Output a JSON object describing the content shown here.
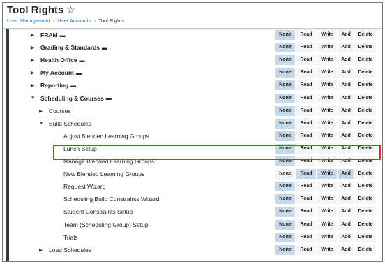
{
  "header": {
    "title": "Tool Rights",
    "star_icon": "star-outline-icon",
    "breadcrumb": [
      "User Management",
      "User Accounts",
      "Tool Rights"
    ]
  },
  "permission_labels": {
    "none": "None",
    "read": "Read",
    "write": "Write",
    "add": "Add",
    "delete": "Delete"
  },
  "colors": {
    "active_permission": "#c6d9ea",
    "highlight_border": "#d32f2f",
    "link": "#1a6fb8"
  },
  "rows": [
    {
      "label": "FRAM",
      "level": 1,
      "caret": "collapsed",
      "folder": true,
      "bold": true,
      "active": [
        "none"
      ]
    },
    {
      "label": "Grading & Standards",
      "level": 1,
      "caret": "collapsed",
      "folder": true,
      "bold": true,
      "active": [
        "none"
      ]
    },
    {
      "label": "Health Office",
      "level": 1,
      "caret": "collapsed",
      "folder": true,
      "bold": true,
      "active": [
        "none"
      ]
    },
    {
      "label": "My Account",
      "level": 1,
      "caret": "collapsed",
      "folder": true,
      "bold": true,
      "active": [
        "none"
      ]
    },
    {
      "label": "Reporting",
      "level": 1,
      "caret": "collapsed",
      "folder": true,
      "bold": true,
      "active": [
        "none"
      ]
    },
    {
      "label": "Scheduling & Courses",
      "level": 1,
      "caret": "expanded",
      "folder": true,
      "bold": true,
      "active": [
        "none"
      ]
    },
    {
      "label": "Courses",
      "level": 2,
      "caret": "collapsed",
      "folder": false,
      "bold": false,
      "active": [
        "none"
      ]
    },
    {
      "label": "Build Schedules",
      "level": 2,
      "caret": "expanded",
      "folder": false,
      "bold": false,
      "active": [
        "none"
      ]
    },
    {
      "label": "Adjust Blended Learning Groups",
      "level": 3,
      "caret": "",
      "folder": false,
      "bold": false,
      "active": [
        "none"
      ]
    },
    {
      "label": "Lunch Setup",
      "level": 3,
      "caret": "",
      "folder": false,
      "bold": false,
      "active": [
        "none"
      ]
    },
    {
      "label": "Manage Blended Learning Groups",
      "level": 3,
      "caret": "",
      "folder": false,
      "bold": false,
      "active": [
        "none"
      ]
    },
    {
      "label": "New Blended Learning Groups",
      "level": 3,
      "caret": "",
      "folder": false,
      "bold": false,
      "active": [
        "read",
        "write",
        "add"
      ],
      "highlighted": true
    },
    {
      "label": "Request Wizard",
      "level": 3,
      "caret": "",
      "folder": false,
      "bold": false,
      "active": [
        "none"
      ]
    },
    {
      "label": "Scheduling Build Constraints Wizard",
      "level": 3,
      "caret": "",
      "folder": false,
      "bold": false,
      "active": [
        "none"
      ]
    },
    {
      "label": "Student Constraints Setup",
      "level": 3,
      "caret": "",
      "folder": false,
      "bold": false,
      "active": [
        "none"
      ]
    },
    {
      "label": "Team (Scheduling Group) Setup",
      "level": 3,
      "caret": "",
      "folder": false,
      "bold": false,
      "active": [
        "none"
      ]
    },
    {
      "label": "Trials",
      "level": 3,
      "caret": "",
      "folder": false,
      "bold": false,
      "active": [
        "none"
      ]
    },
    {
      "label": "Load Schedules",
      "level": 2,
      "caret": "collapsed",
      "folder": false,
      "bold": false,
      "active": [
        "none"
      ]
    }
  ]
}
